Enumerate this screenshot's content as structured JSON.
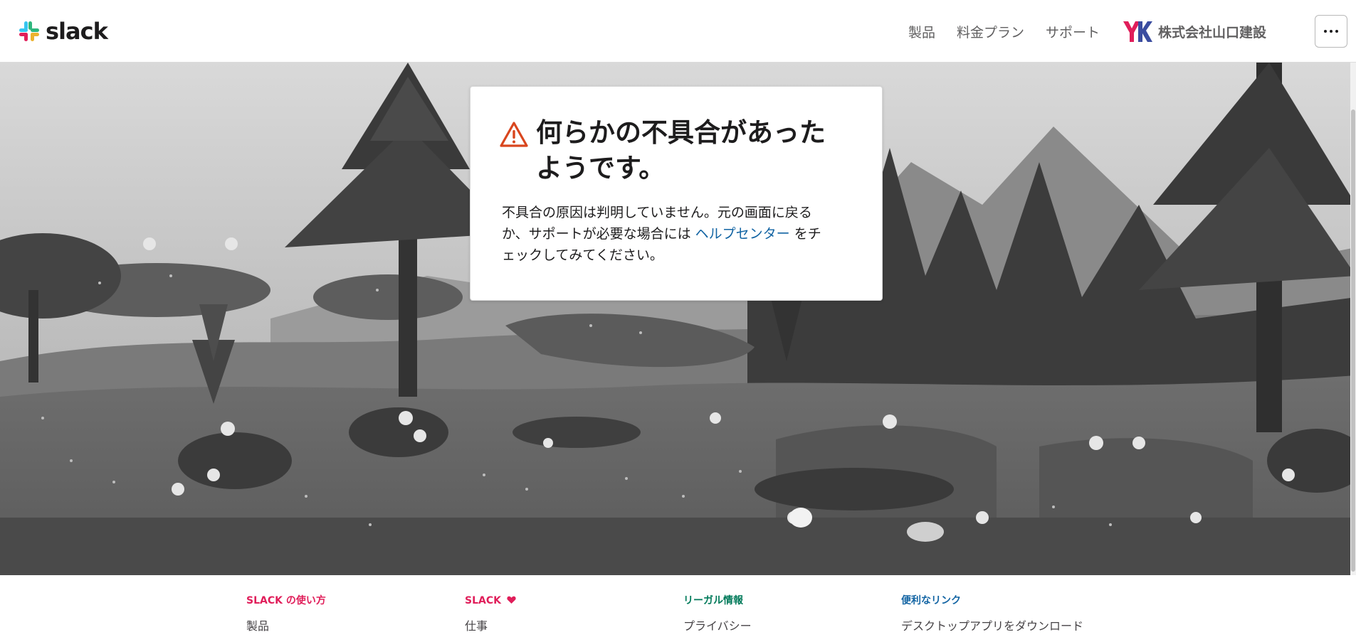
{
  "header": {
    "logo_text": "slack",
    "nav": {
      "products": "製品",
      "pricing": "料金プラン",
      "support": "サポート"
    },
    "workspace": {
      "avatar_initials": "YK",
      "name": "株式会社山口建設"
    },
    "more_icon": "ellipsis-icon"
  },
  "error_card": {
    "icon": "warning-icon",
    "title_line1": "何らかの不具合があった",
    "title_line2": "ようです。",
    "body_line1": "不具合の原因は判明していません。元の画面に戻る",
    "body_line2_prefix": "か、サポートが必要な場合には ",
    "help_link": "ヘルプセンター",
    "body_line2_suffix": " をチ",
    "body_line3": "ェックしてみてください。"
  },
  "footer": {
    "columns": [
      {
        "heading": "SLACK の使い方",
        "first_link": "製品",
        "color": "#e01e5a"
      },
      {
        "heading": "SLACK",
        "heart_icon": "heart-icon",
        "first_link": "仕事",
        "color": "#e01e5a"
      },
      {
        "heading": "リーガル情報",
        "first_link": "プライバシー",
        "color": "#007a5a"
      },
      {
        "heading": "便利なリンク",
        "first_link": "デスクトップアプリをダウンロード",
        "color": "#1264a3"
      }
    ]
  },
  "colors": {
    "warning": "#e01e5a",
    "link": "#1264a3",
    "text": "#1d1c1d",
    "nav_text": "#616061"
  }
}
